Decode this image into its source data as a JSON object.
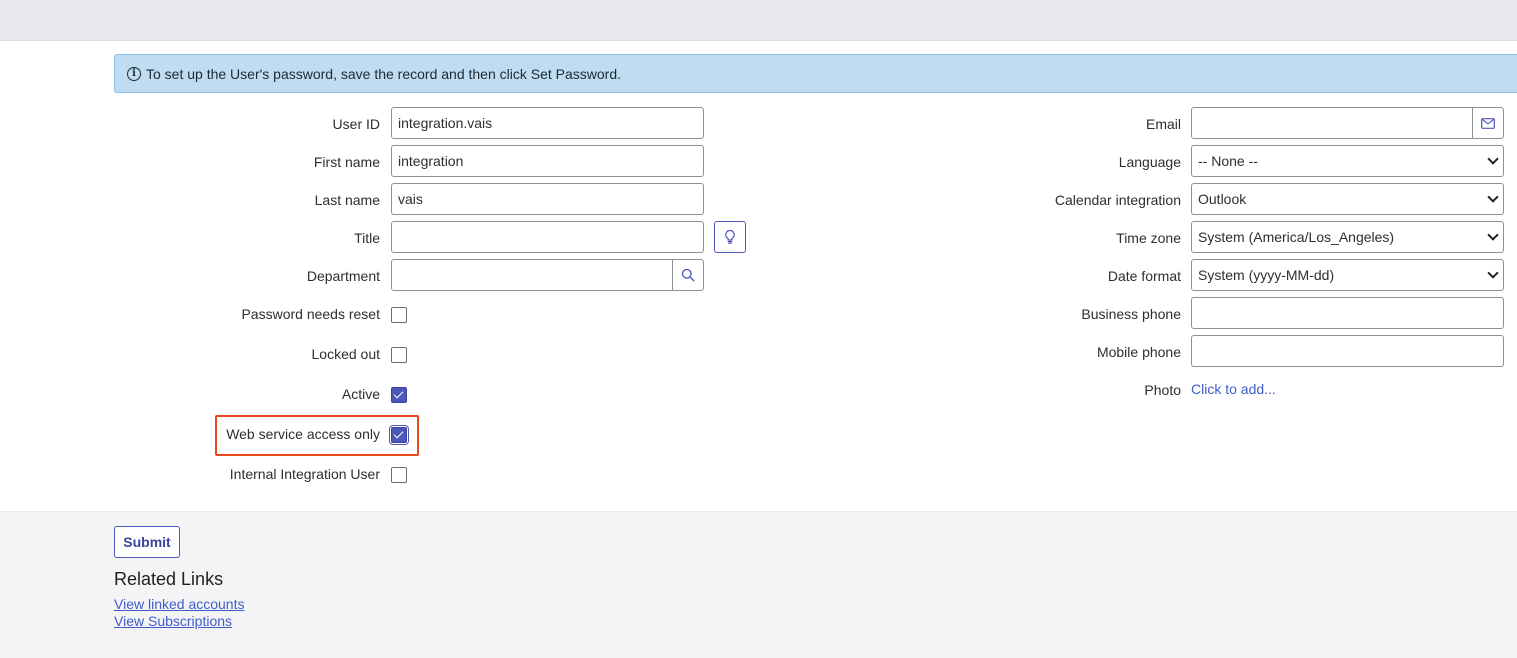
{
  "banner": {
    "text": "To set up the User's password, save the record and then click Set Password."
  },
  "left_fields": {
    "user_id": {
      "label": "User ID",
      "value": "integration.vais"
    },
    "first_name": {
      "label": "First name",
      "value": "integration"
    },
    "last_name": {
      "label": "Last name",
      "value": "vais"
    },
    "title": {
      "label": "Title",
      "value": ""
    },
    "department": {
      "label": "Department",
      "value": ""
    },
    "password_needs_reset": {
      "label": "Password needs reset",
      "checked": false
    },
    "locked_out": {
      "label": "Locked out",
      "checked": false
    },
    "active": {
      "label": "Active",
      "checked": true
    },
    "web_service_access_only": {
      "label": "Web service access only",
      "checked": true
    },
    "internal_integration_user": {
      "label": "Internal Integration User",
      "checked": false
    }
  },
  "right_fields": {
    "email": {
      "label": "Email",
      "value": ""
    },
    "language": {
      "label": "Language",
      "value": "-- None --"
    },
    "calendar_integration": {
      "label": "Calendar integration",
      "value": "Outlook"
    },
    "time_zone": {
      "label": "Time zone",
      "value": "System (America/Los_Angeles)"
    },
    "date_format": {
      "label": "Date format",
      "value": "System (yyyy-MM-dd)"
    },
    "business_phone": {
      "label": "Business phone",
      "value": ""
    },
    "mobile_phone": {
      "label": "Mobile phone",
      "value": ""
    },
    "photo": {
      "label": "Photo",
      "link": "Click to add..."
    }
  },
  "footer": {
    "submit_label": "Submit",
    "related_links_title": "Related Links",
    "links": [
      "View linked accounts",
      "View Subscriptions"
    ]
  },
  "colors": {
    "accent": "#4d57b9",
    "highlight": "#e8471c",
    "banner_bg": "#bfdcf2"
  }
}
